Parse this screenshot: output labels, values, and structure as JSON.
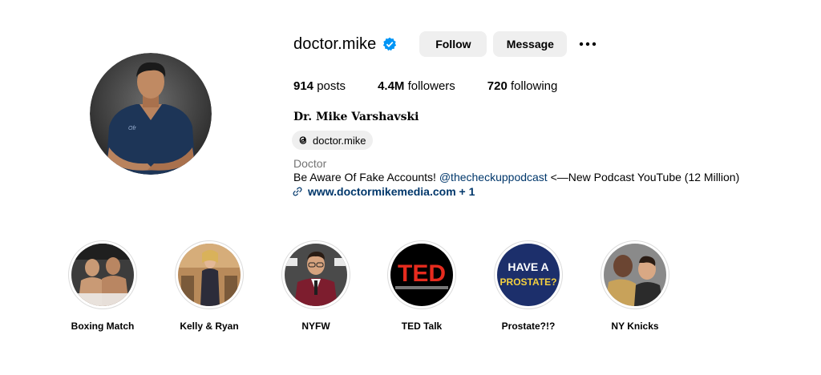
{
  "profile": {
    "username": "doctor.mike",
    "verified_icon": "verified-badge-icon",
    "follow_label": "Follow",
    "message_label": "Message",
    "more_icon": "more-options-icon",
    "stats": {
      "posts_count": "914",
      "posts_label": "posts",
      "followers_count": "4.4M",
      "followers_label": "followers",
      "following_count": "720",
      "following_label": "following"
    },
    "full_name": "Dr. Mike Varshavski",
    "threads_handle": "doctor.mike",
    "category": "Doctor",
    "bio_prefix": "Be Aware Of Fake Accounts! ",
    "bio_mention": "@thecheckuppodcast",
    "bio_suffix": " <—New Podcast YouTube (12 Million)",
    "link_text": "www.doctormikemedia.com + 1"
  },
  "highlights": [
    {
      "label": "Boxing Match",
      "cover_text": ""
    },
    {
      "label": "Kelly & Ryan",
      "cover_text": ""
    },
    {
      "label": "NYFW",
      "cover_text": ""
    },
    {
      "label": "TED Talk",
      "cover_text": "TED"
    },
    {
      "label": "Prostate?!?",
      "cover_text_1": "HAVE A",
      "cover_text_2": "PROSTATE?"
    },
    {
      "label": "NY Knicks",
      "cover_text": ""
    }
  ],
  "colors": {
    "button_bg": "#efefef",
    "link": "#00376b",
    "verified": "#0095f6",
    "muted": "#737373",
    "ted_red": "#e62b1e",
    "prostate_navy": "#1c2f6b",
    "prostate_yellow": "#f4d03f"
  }
}
